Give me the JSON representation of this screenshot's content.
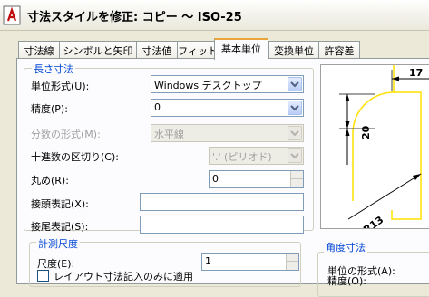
{
  "window": {
    "title": "寸法スタイルを修正: コピー ～ ISO-25"
  },
  "tabs": [
    {
      "label": "寸法線"
    },
    {
      "label": "シンボルと矢印"
    },
    {
      "label": "寸法値"
    },
    {
      "label": "フィット"
    },
    {
      "label": "基本単位"
    },
    {
      "label": "変換単位"
    },
    {
      "label": "許容差"
    }
  ],
  "linear": {
    "group_title": "長さ寸法",
    "unit_format_label": "単位形式(U):",
    "unit_format_value": "Windows デスクトップ",
    "precision_label": "精度(P):",
    "precision_value": "0",
    "fraction_label": "分数の形式(M):",
    "fraction_value": "水平線",
    "decimal_sep_label": "十進数の区切り(C):",
    "decimal_sep_value": "'.' (ピリオド)",
    "round_off_label": "丸め(R):",
    "round_off_value": "0",
    "prefix_label": "接頭表記(X):",
    "prefix_value": "",
    "suffix_label": "接尾表記(S):",
    "suffix_value": ""
  },
  "measurement_scale": {
    "group_title": "計測尺度",
    "scale_factor_label": "尺度(E):",
    "scale_factor_value": "1",
    "layout_only_label": "レイアウト寸法記入のみに適用"
  },
  "preview": {
    "dim_horizontal": "17",
    "dim_vertical": "20",
    "dim_radius": "R13"
  },
  "angular": {
    "group_title": "角度寸法",
    "unit_format_label": "単位の形式(A):",
    "precision_label": "精度(O):"
  },
  "colors": {
    "group_title": "#0046d5",
    "active_tab_accent": "#e8a53a"
  }
}
